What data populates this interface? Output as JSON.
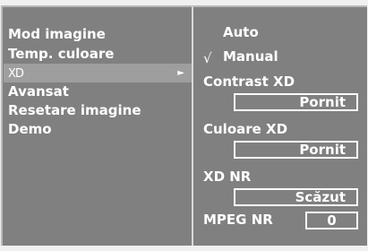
{
  "left_menu": {
    "items": [
      {
        "label": "Mod imagine"
      },
      {
        "label": "Temp. culoare"
      },
      {
        "label": "XD",
        "arrow": "►"
      },
      {
        "label": "Avansat"
      },
      {
        "label": "Resetare imagine"
      },
      {
        "label": "Demo"
      }
    ]
  },
  "right_menu": {
    "auto_label": "Auto",
    "check_mark": "√",
    "manual_label": "Manual",
    "contrast_label": "Contrast XD",
    "contrast_value": "Pornit",
    "color_label": "Culoare XD",
    "color_value": "Pornit",
    "nr_label": "XD NR",
    "nr_value": "Scăzut",
    "mpeg_label": "MPEG NR",
    "mpeg_value": "0"
  }
}
